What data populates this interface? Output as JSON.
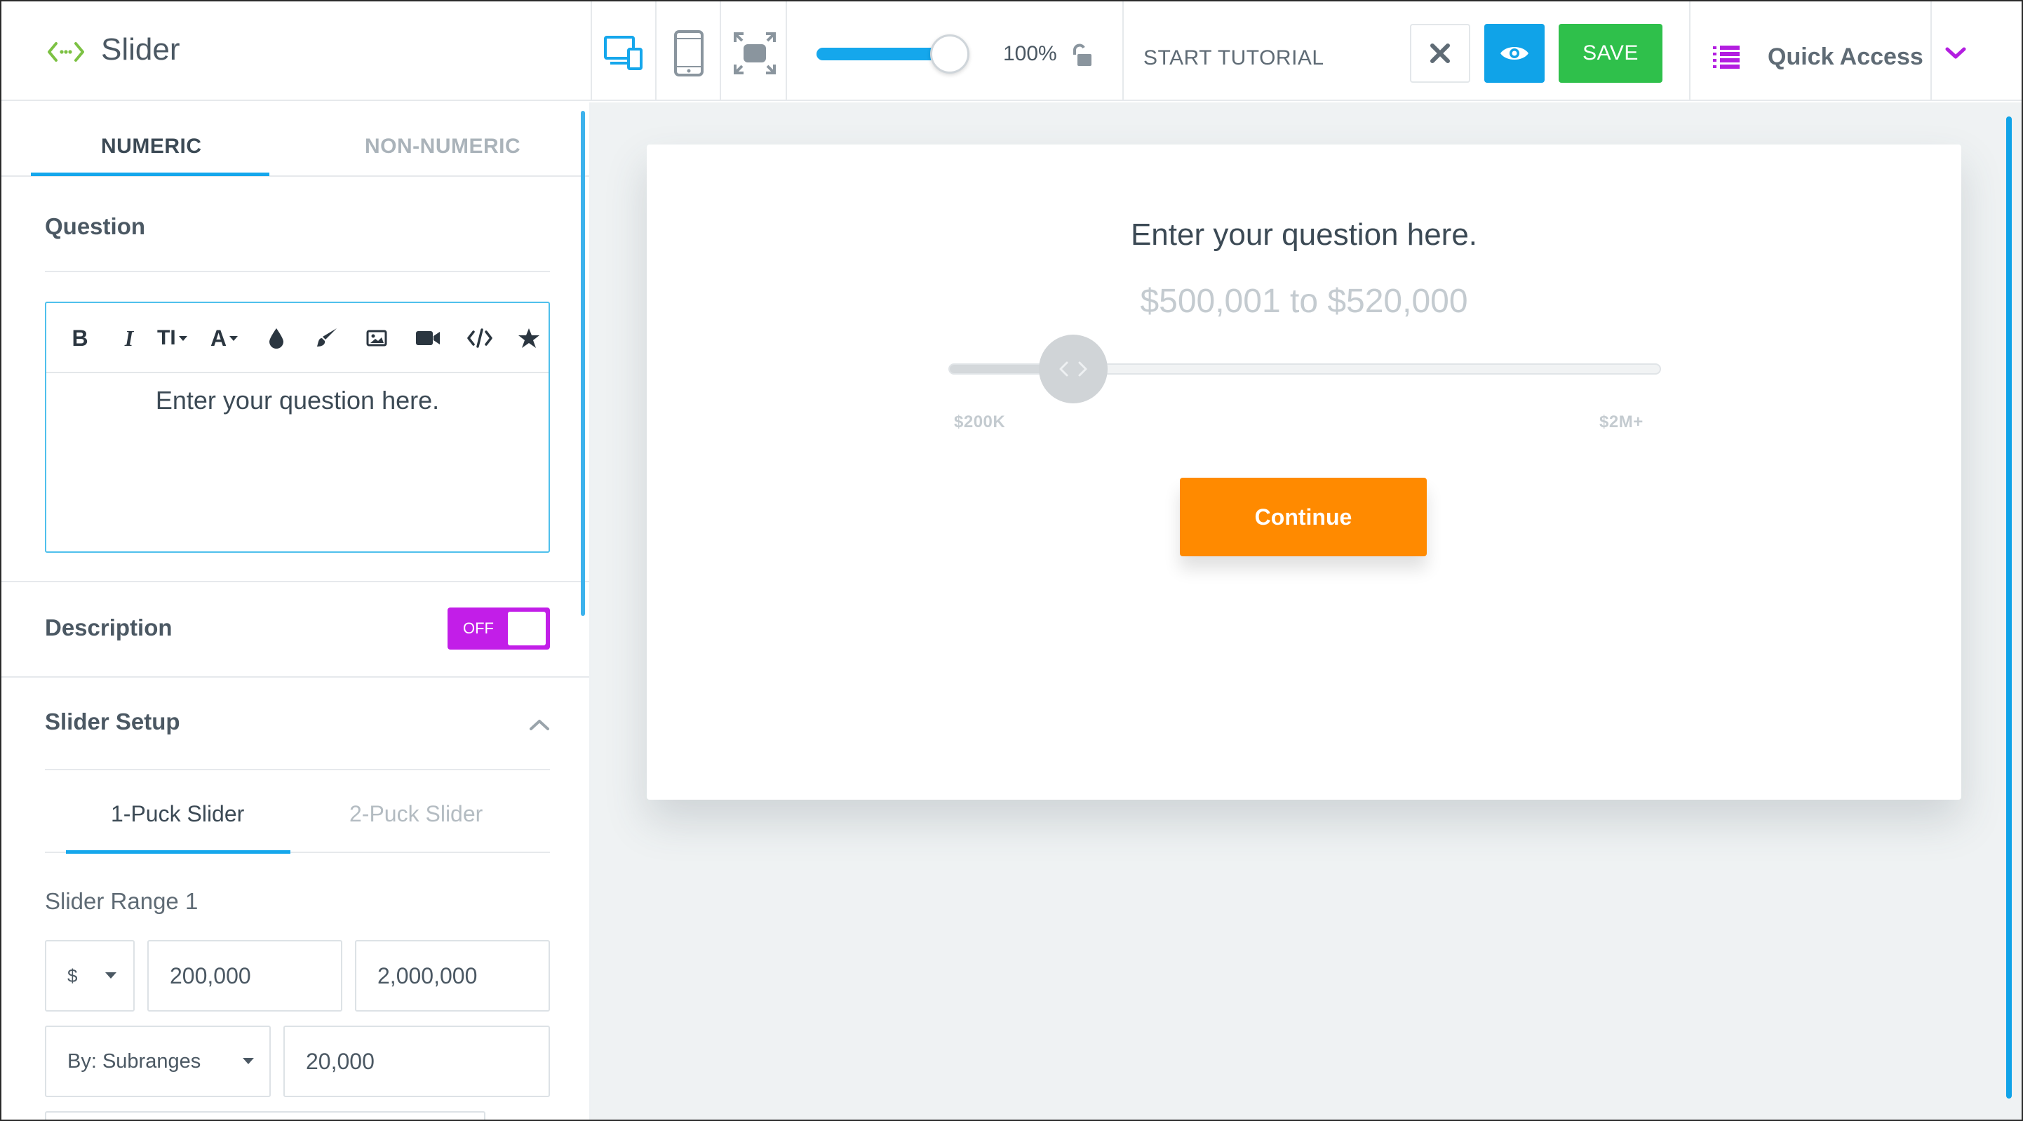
{
  "header": {
    "app_title": "Slider",
    "zoom": {
      "value_label": "100%",
      "level": 1.0
    },
    "tutorial_label": "START TUTORIAL",
    "save_label": "SAVE",
    "quick_access_label": "Quick Access",
    "icons": [
      "slider-logo-icon",
      "responsive-devices-icon",
      "mobile-icon",
      "fullscreen-icon",
      "unlock-icon",
      "close-icon",
      "eye-icon",
      "list-icon",
      "chevron-down-icon"
    ]
  },
  "left_panel": {
    "tabs": [
      {
        "label": "NUMERIC",
        "active": true
      },
      {
        "label": "NON-NUMERIC",
        "active": false
      }
    ],
    "question_title": "Question",
    "editor": {
      "text": "Enter your question here.",
      "tools": [
        "bold",
        "italic",
        "text-size",
        "font",
        "color-drop",
        "brush",
        "image",
        "video",
        "code",
        "star"
      ],
      "bold_glyph": "B",
      "italic_glyph": "I",
      "text_size_glyph": "TI",
      "font_glyph": "A"
    },
    "description": {
      "label": "Description",
      "toggle_label": "OFF",
      "on": false
    },
    "slider_setup": {
      "title": "Slider Setup",
      "subtabs": [
        {
          "label": "1-Puck Slider",
          "active": true
        },
        {
          "label": "2-Puck Slider",
          "active": false
        }
      ],
      "range_label": "Slider Range 1",
      "currency": "$",
      "min_value": "200,000",
      "max_value": "2,000,000",
      "step_mode": "By: Subranges",
      "step_value": "20,000"
    }
  },
  "preview": {
    "question": "Enter your question here.",
    "range_text": "$500,001 to $520,000",
    "slider": {
      "min_label": "$200K",
      "max_label": "$2M+",
      "position": 0.175
    },
    "continue_label": "Continue"
  },
  "colors": {
    "accent_blue": "#15a7ec",
    "save_green": "#2fc04b",
    "toggle_purple": "#c21ee8",
    "continue_orange": "#ff8a00",
    "logo_green": "#7cc143",
    "quick_access_purple": "#b31ee0"
  }
}
